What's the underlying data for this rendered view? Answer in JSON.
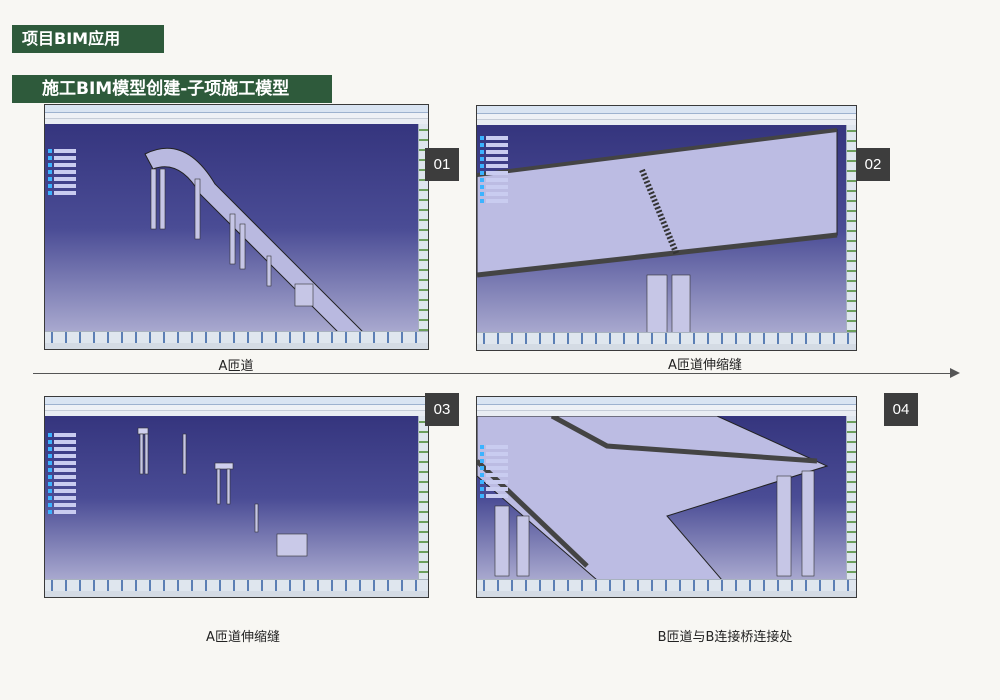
{
  "header": {
    "section_title": "项目BIM应用",
    "subsection_title": "施工BIM模型创建-子项施工模型"
  },
  "panels": [
    {
      "number": "01",
      "caption": "A匝道"
    },
    {
      "number": "02",
      "caption": "A匝道伸缩缝"
    },
    {
      "number": "03",
      "caption": "A匝道伸缩缝"
    },
    {
      "number": "04",
      "caption": "B匝道与B连接桥连接处"
    }
  ],
  "colors": {
    "banner": "#2e5a3b",
    "badge": "#3d3d3d",
    "viewport_top": "#35357e",
    "viewport_bottom": "#a9a9cf"
  }
}
